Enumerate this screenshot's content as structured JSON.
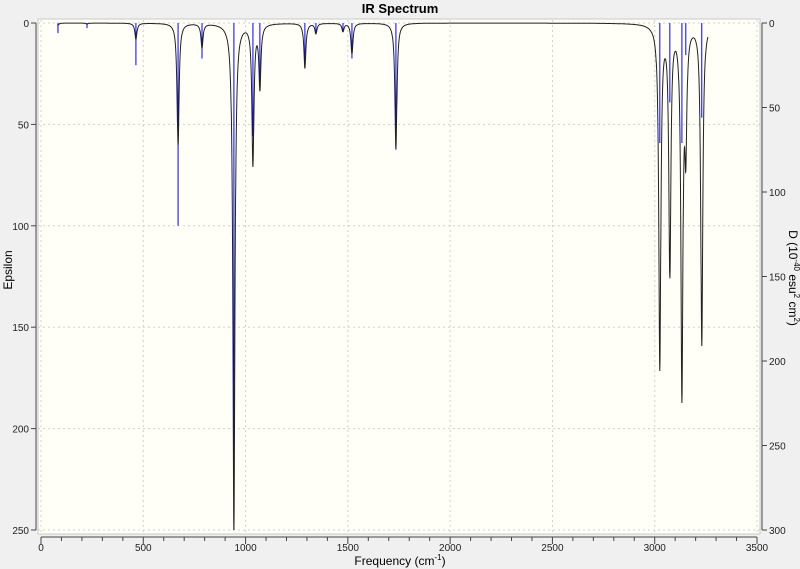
{
  "chart_data": {
    "type": "line",
    "title": "IR Spectrum",
    "xlabel": "Frequency (cm-1)",
    "xlabel_base": "Frequency (cm",
    "xlabel_sup": "-1",
    "xlabel_end": ")",
    "ylabel": "Epsilon",
    "ylabel_right": "D (10-40 esu2 cm2)",
    "ylabel_right_parts": [
      "D (10",
      "-40",
      " esu",
      "2",
      " cm",
      "2",
      ")"
    ],
    "xlim": [
      0,
      3500
    ],
    "ylim": [
      0,
      250
    ],
    "ylim_right": [
      0,
      300
    ],
    "y_inverted": true,
    "grid": true,
    "xticks": [
      0,
      500,
      1000,
      1500,
      2000,
      2500,
      3000,
      3500
    ],
    "yticks": [
      0,
      50,
      100,
      150,
      200,
      250
    ],
    "yticks_right": [
      0,
      50,
      100,
      150,
      200,
      250,
      300
    ],
    "colors": {
      "spectrum": "#000000",
      "sticks": "#0000ff",
      "plot_bg": "#fffff8",
      "background": "#f0f0f0"
    },
    "series": [
      {
        "kind": "spectrum-epsilon",
        "peaks_freq": [
          83,
          225,
          464,
          670,
          787,
          943,
          1036,
          1070,
          1290,
          1344,
          1476,
          1520,
          1735,
          3025,
          3074,
          3133,
          3152,
          3230
        ],
        "peaks_epsilon": [
          1,
          0.5,
          8,
          60,
          12,
          250,
          69,
          31,
          22,
          5,
          4,
          15,
          62,
          169,
          121,
          180,
          55,
          158
        ]
      },
      {
        "kind": "sticks-D",
        "freq": [
          83,
          225,
          464,
          670,
          787,
          943,
          1036,
          1070,
          1290,
          1344,
          1476,
          1520,
          1735,
          3025,
          3074,
          3133,
          3152,
          3230
        ],
        "D": [
          6,
          3,
          25,
          120,
          21,
          300,
          67,
          38,
          27,
          6,
          5,
          21,
          75,
          71,
          47,
          71,
          19,
          56
        ]
      }
    ]
  }
}
